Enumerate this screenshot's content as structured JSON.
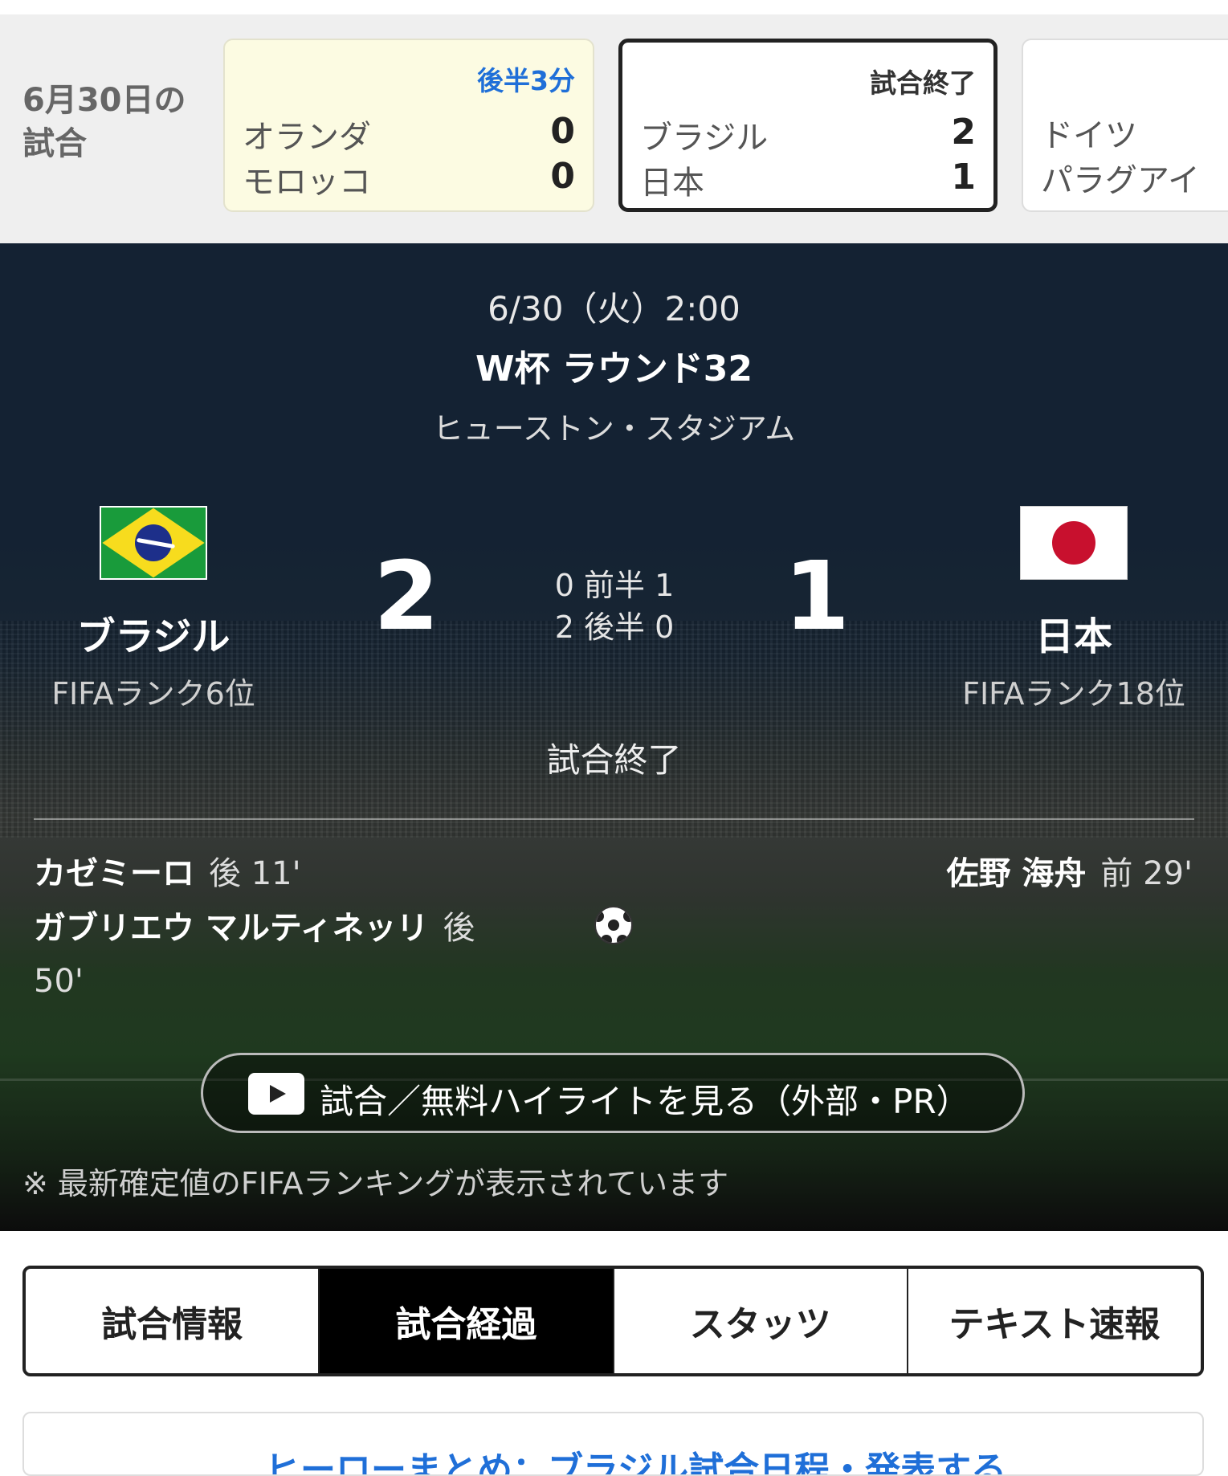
{
  "carousel": {
    "date_label_line1": "6月30日の",
    "date_label_line2": "試合",
    "cards": [
      {
        "status": "後半3分",
        "home": "オランダ",
        "away": "モロッコ",
        "home_score": "0",
        "away_score": "0"
      },
      {
        "status": "試合終了",
        "home": "ブラジル",
        "away": "日本",
        "home_score": "2",
        "away_score": "1"
      },
      {
        "home": "ドイツ",
        "away": "パラグアイ"
      }
    ]
  },
  "match": {
    "datetime": "6/30（火）2:00",
    "round": "W杯 ラウンド32",
    "venue": "ヒューストン・スタジアム",
    "home": {
      "name": "ブラジル",
      "rank": "FIFAランク6位",
      "score": "2",
      "flag": "brazil-flag"
    },
    "away": {
      "name": "日本",
      "rank": "FIFAランク18位",
      "score": "1",
      "flag": "japan-flag"
    },
    "first_half": "0 前半 1",
    "second_half": "2 後半 0",
    "status": "試合終了",
    "home_scorers": [
      {
        "name": "カゼミーロ",
        "minute": "後 11'"
      },
      {
        "name": "ガブリエウ マルティネッリ",
        "minute": "後 50'"
      }
    ],
    "away_scorers": [
      {
        "name": "佐野 海舟",
        "minute": "前 29'"
      }
    ],
    "goal_icon": "soccer-ball-icon",
    "highlight_label": "試合／無料ハイライトを見る（外部・PR）",
    "note": "※ 最新確定値のFIFAランキングが表示されています"
  },
  "tabs": [
    {
      "label": "試合情報",
      "active": false
    },
    {
      "label": "試合経過",
      "active": true
    },
    {
      "label": "スタッツ",
      "active": false
    },
    {
      "label": "テキスト速報",
      "active": false
    }
  ],
  "bottom_card_text": "ヒーローまとめ：ブラジル試合日程・発表する"
}
